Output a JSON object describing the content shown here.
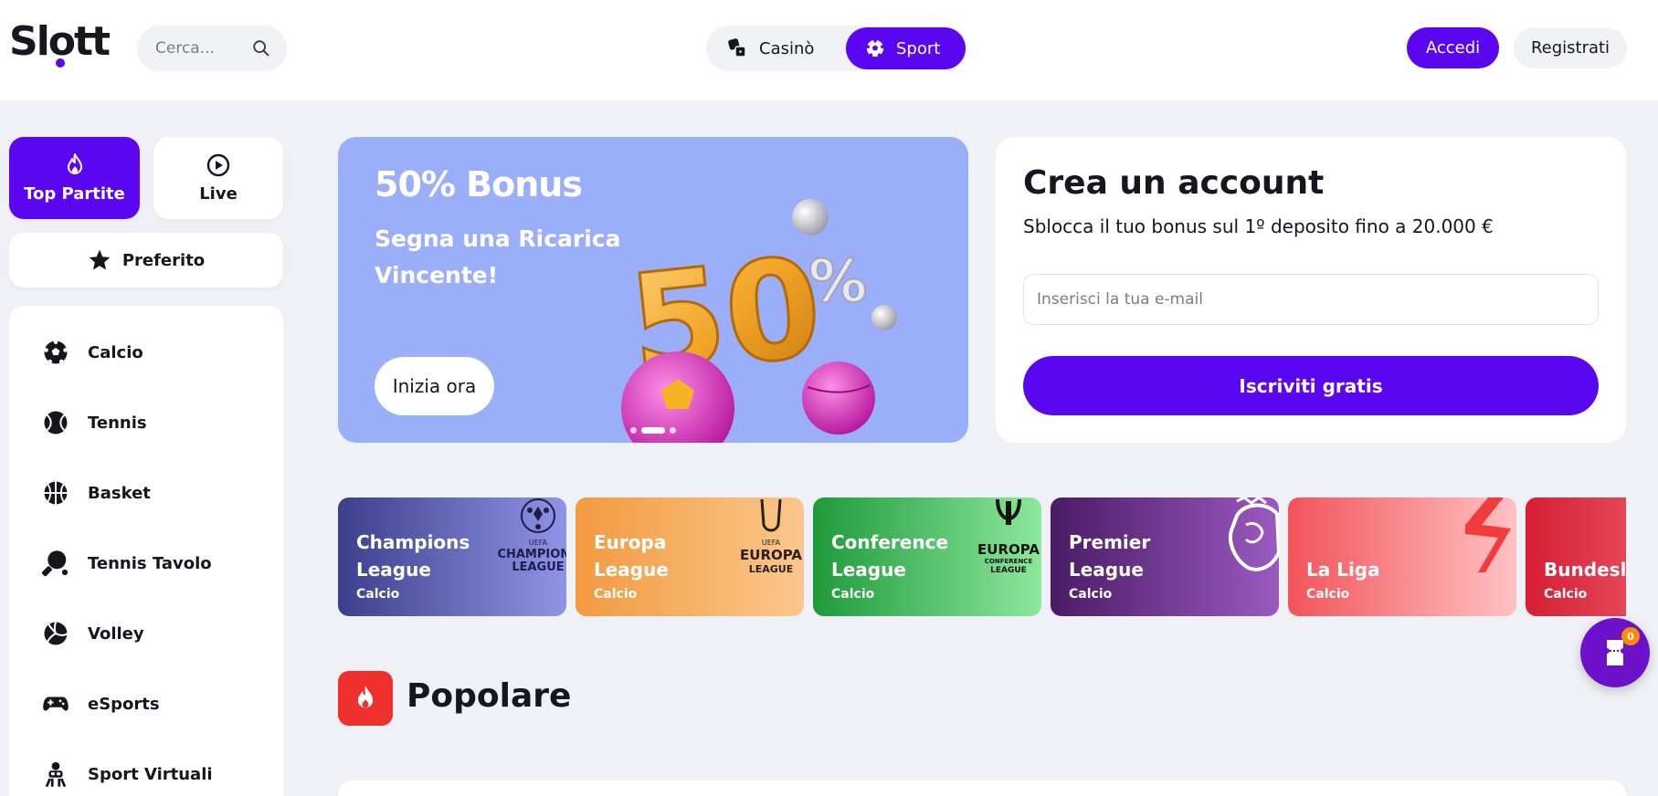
{
  "header": {
    "logo": "Slott",
    "search_placeholder": "Cerca...",
    "toggle": {
      "casino": "Casinò",
      "sport": "Sport",
      "active": "Sport"
    },
    "login": "Accedi",
    "register": "Registrati"
  },
  "sidebar": {
    "tabs": [
      {
        "label": "Top Partite",
        "icon": "flame-icon",
        "active": true
      },
      {
        "label": "Live",
        "icon": "play-circle-icon",
        "active": false
      }
    ],
    "favorite": {
      "label": "Preferito",
      "icon": "star-icon"
    },
    "sports": [
      {
        "label": "Calcio",
        "icon": "soccer-ball-icon"
      },
      {
        "label": "Tennis",
        "icon": "tennis-ball-icon"
      },
      {
        "label": "Basket",
        "icon": "basketball-icon"
      },
      {
        "label": "Tennis Tavolo",
        "icon": "ping-pong-icon"
      },
      {
        "label": "Volley",
        "icon": "volleyball-icon"
      },
      {
        "label": "eSports",
        "icon": "gamepad-icon"
      },
      {
        "label": "Sport Virtuali",
        "icon": "vr-player-icon"
      }
    ]
  },
  "promo": {
    "title": "50% Bonus",
    "subtitle": "Segna una Ricarica Vincente!",
    "cta": "Inizia ora",
    "slides": 3,
    "active_slide": 2
  },
  "account": {
    "title": "Crea un account",
    "subtitle": "Sblocca il tuo bonus sul 1º deposito fino a 20.000 €",
    "email_placeholder": "Inserisci la tua e-mail",
    "cta": "Iscriviti gratis"
  },
  "leagues": [
    {
      "name": "Champions League",
      "category": "Calcio",
      "color": "#3b3f8c",
      "logo_text": "UEFA CHAMPIONS LEAGUE"
    },
    {
      "name": "Europa League",
      "category": "Calcio",
      "color": "#f29a3f",
      "logo_text": "UEFA EUROPA LEAGUE"
    },
    {
      "name": "Conference League",
      "category": "Calcio",
      "color": "#1f9a3a",
      "logo_text": "UEFA EUROPA CONFERENCE LEAGUE"
    },
    {
      "name": "Premier League",
      "category": "Calcio",
      "color": "#5a2178",
      "logo_text": ""
    },
    {
      "name": "La Liga",
      "category": "Calcio",
      "color": "#f2545a",
      "logo_text": ""
    },
    {
      "name": "Bundesliga",
      "category": "Calcio",
      "color": "#d61d33",
      "logo_text": ""
    }
  ],
  "popular": {
    "title": "Popolare",
    "icon": "flame-icon"
  },
  "cart": {
    "count": "0"
  },
  "colors": {
    "accent": "#5b06f0",
    "promo_bg": "#9aaefa",
    "page_bg": "#f0f1f6"
  }
}
